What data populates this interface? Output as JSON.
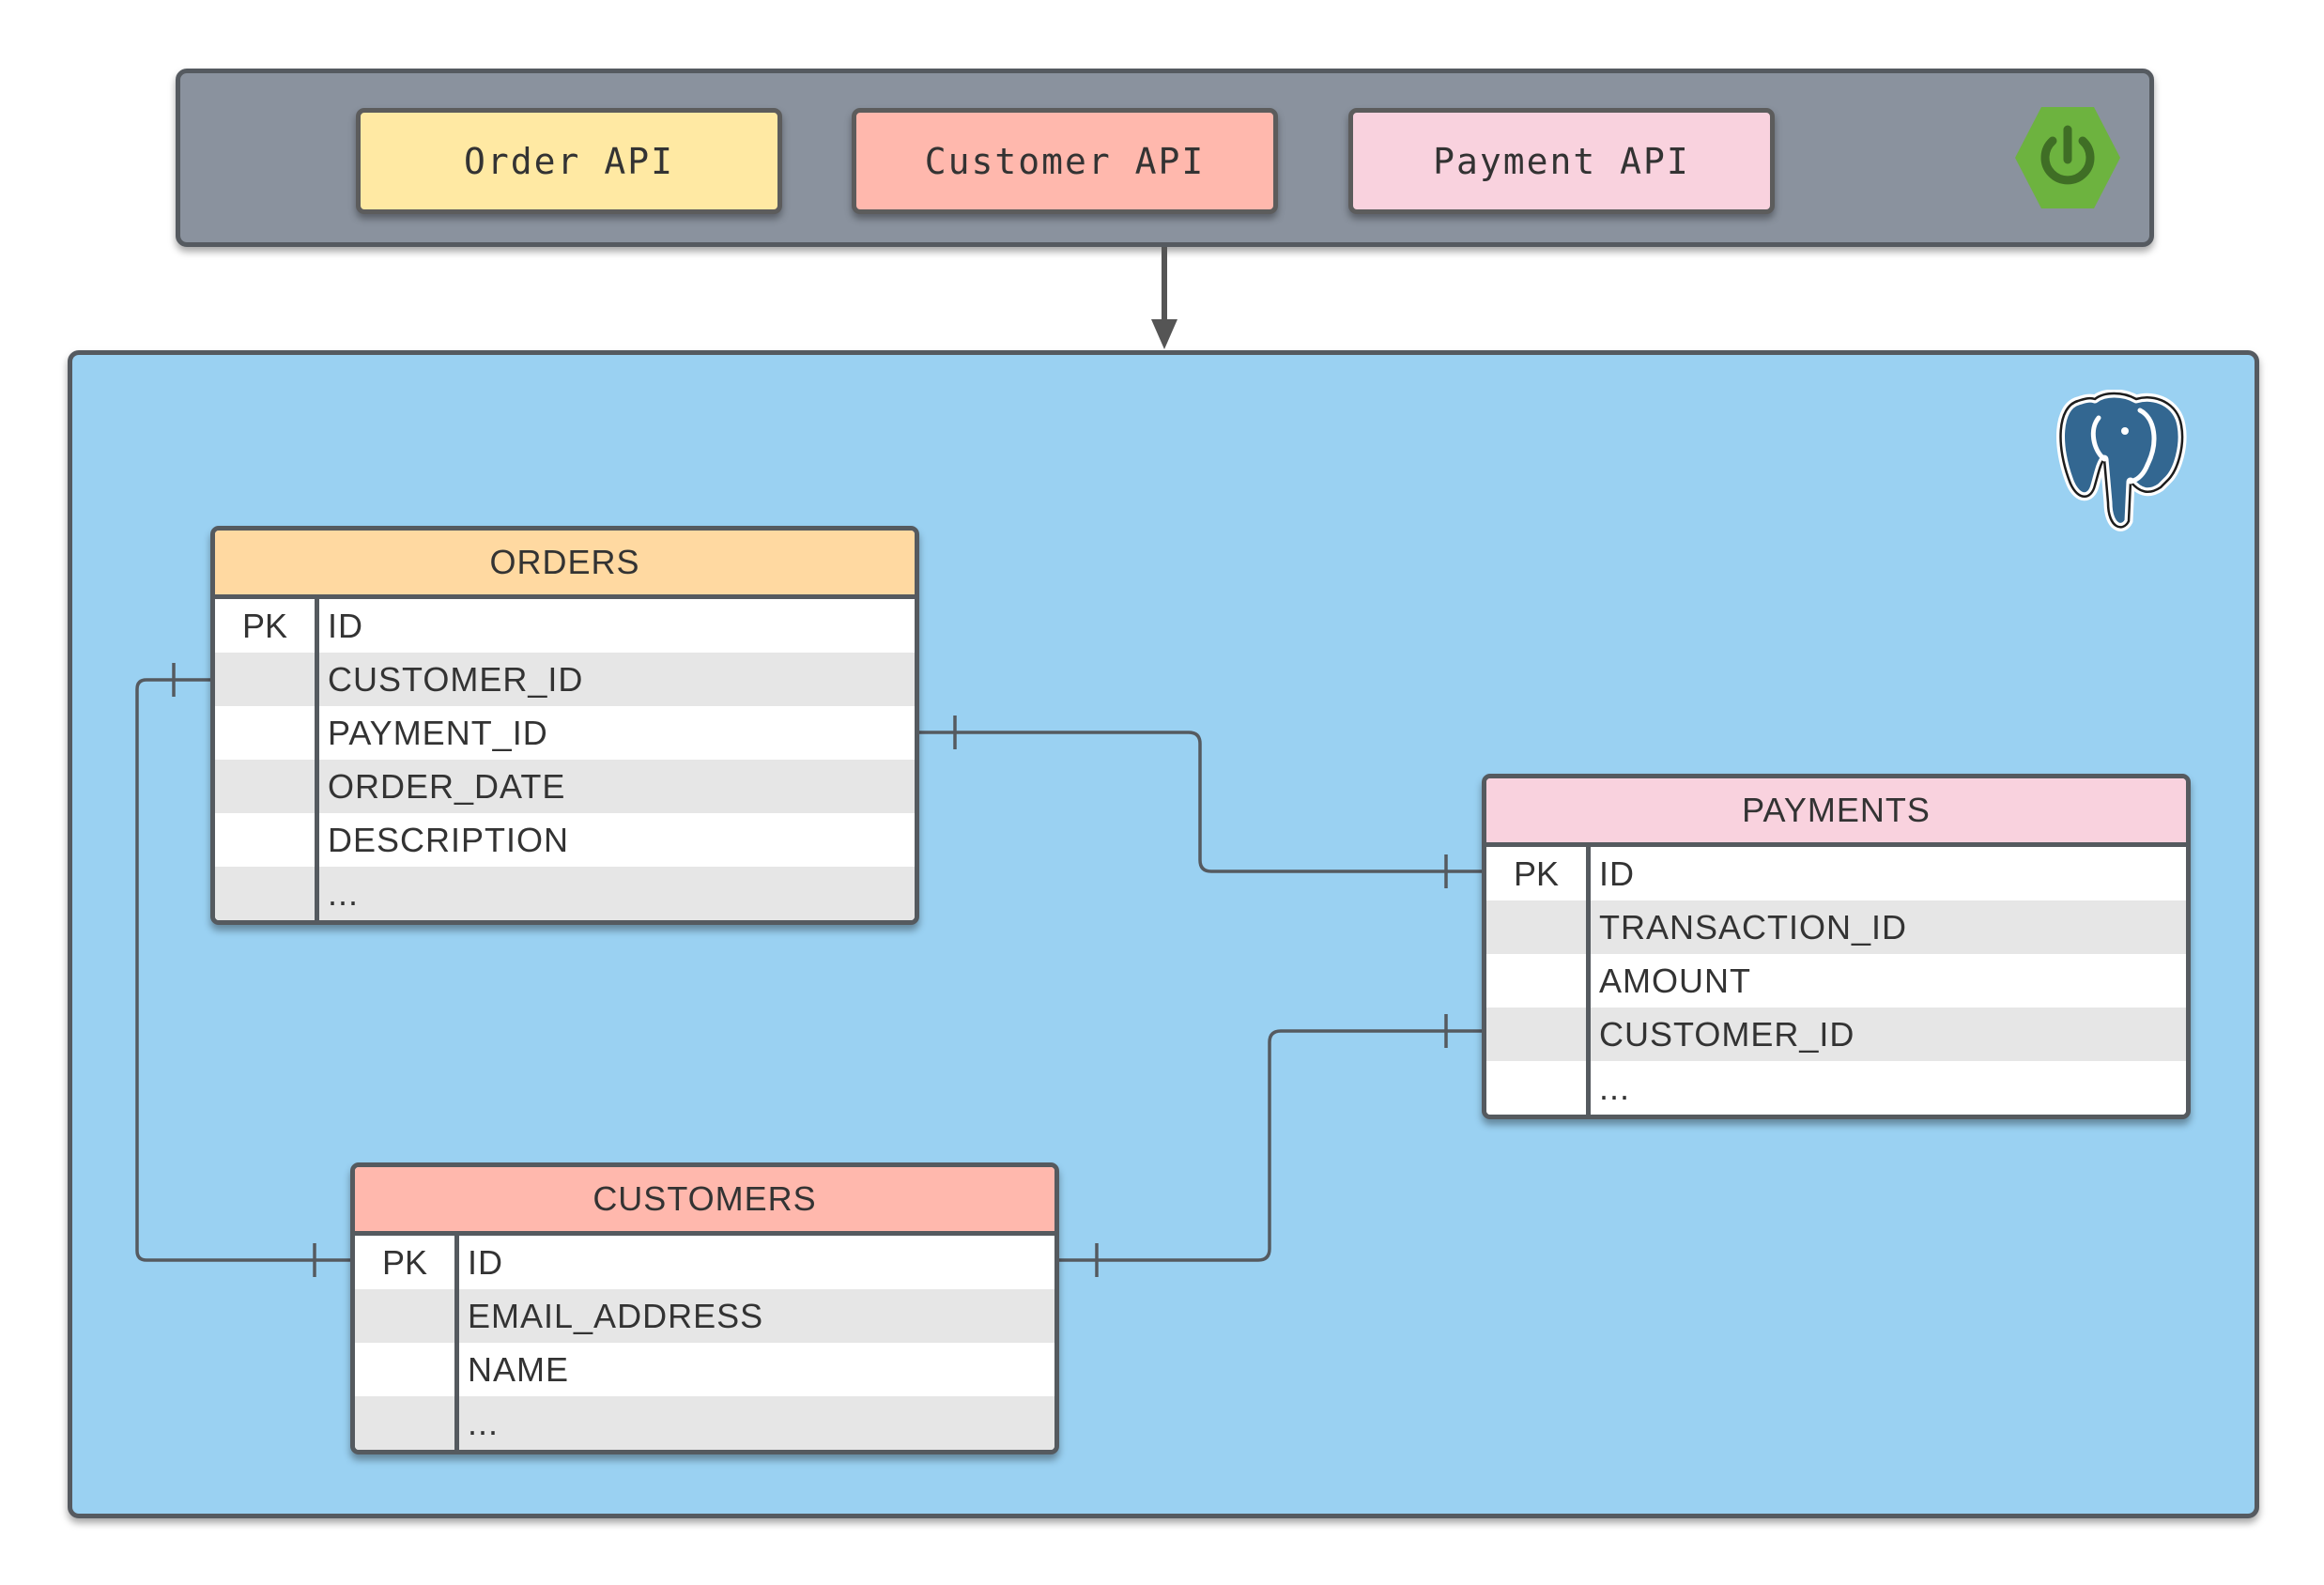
{
  "apis": [
    {
      "label": "Order API",
      "color": "#ffe9a3"
    },
    {
      "label": "Customer API",
      "color": "#ffb8ad"
    },
    {
      "label": "Payment API",
      "color": "#f9d2de"
    }
  ],
  "icons": {
    "framework": "spring-power-icon",
    "database": "postgresql-elephant-icon"
  },
  "colors": {
    "api_bar": "#8a929e",
    "database_area": "#9ad1f2",
    "spring_green": "#6db33f",
    "postgres_blue": "#336791"
  },
  "tables": {
    "orders": {
      "name": "ORDERS",
      "header_color": "#ffd9a1",
      "rows": [
        {
          "key": "PK",
          "column": "ID"
        },
        {
          "key": "",
          "column": "CUSTOMER_ID"
        },
        {
          "key": "",
          "column": "PAYMENT_ID"
        },
        {
          "key": "",
          "column": "ORDER_DATE"
        },
        {
          "key": "",
          "column": "DESCRIPTION"
        },
        {
          "key": "",
          "column": "..."
        }
      ]
    },
    "payments": {
      "name": "PAYMENTS",
      "header_color": "#f9d2de",
      "rows": [
        {
          "key": "PK",
          "column": "ID"
        },
        {
          "key": "",
          "column": "TRANSACTION_ID"
        },
        {
          "key": "",
          "column": "AMOUNT"
        },
        {
          "key": "",
          "column": "CUSTOMER_ID"
        },
        {
          "key": "",
          "column": "..."
        }
      ]
    },
    "customers": {
      "name": "CUSTOMERS",
      "header_color": "#ffb8ad",
      "rows": [
        {
          "key": "PK",
          "column": "ID"
        },
        {
          "key": "",
          "column": "EMAIL_ADDRESS"
        },
        {
          "key": "",
          "column": "NAME"
        },
        {
          "key": "",
          "column": "..."
        }
      ]
    }
  },
  "relationships": [
    {
      "from": "ORDERS.CUSTOMER_ID",
      "to": "CUSTOMERS.ID"
    },
    {
      "from": "ORDERS.PAYMENT_ID",
      "to": "PAYMENTS.ID"
    },
    {
      "from": "PAYMENTS.CUSTOMER_ID",
      "to": "CUSTOMERS.ID"
    }
  ]
}
